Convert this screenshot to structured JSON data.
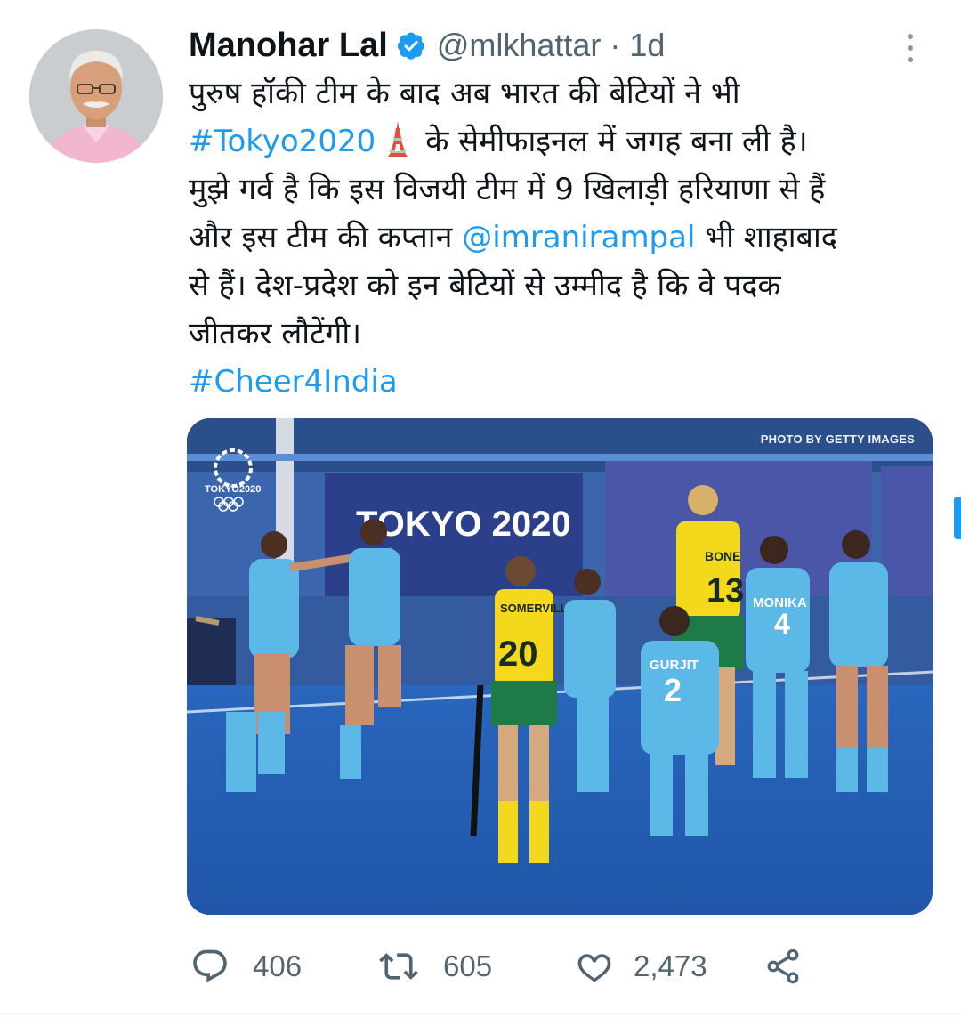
{
  "author": {
    "name": "Manohar Lal",
    "handle": "@mlkhattar",
    "separator": "·",
    "time": "1d"
  },
  "tweet": {
    "line1": "पुरुष हॉकी टीम के बाद अब भारत की बेटियों ने भी",
    "hashtag_tokyo": "#Tokyo2020",
    "line2_rest": "के सेमीफाइनल में जगह बना ली है।",
    "line3": "मुझे गर्व है कि इस विजयी टीम में 9 खिलाड़ी हरियाणा से हैं",
    "line4_pre": "और इस टीम की कप्तान ",
    "mention": "@imranirampal",
    "line4_post": " भी शाहाबाद",
    "line5": "से हैं। देश-प्रदेश को इन बेटियों से उम्मीद है कि वे पदक",
    "line6": "जीतकर लौटेंगी।",
    "hashtag_cheer": "#Cheer4India"
  },
  "media": {
    "credit": "PHOTO BY GETTY IMAGES",
    "banner_text": "TOKYO 2020",
    "badge_text": "TOKYO2020",
    "jerseys": {
      "somerville_name": "SOMERVILLE",
      "somerville_num": "20",
      "bone_name": "BONE",
      "bone_num": "13",
      "gurjit_name": "GURJIT",
      "gurjit_num": "2",
      "monika_name": "MONIKA",
      "monika_num": "4"
    }
  },
  "stats": {
    "replies": "406",
    "retweets": "605",
    "likes": "2,473"
  },
  "colors": {
    "link": "#1d9bf0",
    "muted": "#536471",
    "pitch": "#2560b6",
    "india_jersey": "#5cb8e6",
    "aus_jersey": "#f3d81c"
  }
}
